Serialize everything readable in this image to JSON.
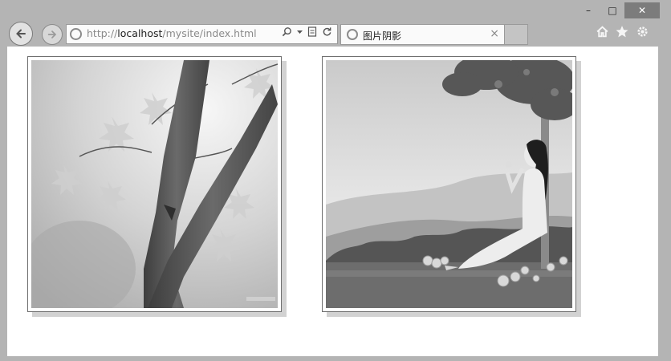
{
  "browser": {
    "address_bar": {
      "scheme": "http://",
      "host": "localhost",
      "path": "/mysite/index.html"
    },
    "tab": {
      "title": "图片阴影",
      "close": "×"
    },
    "window_controls": {
      "minimize": "–",
      "maximize": "□",
      "close": "✕"
    },
    "toolbar_icons": [
      "back-icon",
      "forward-icon",
      "search-icon",
      "dropdown-icon",
      "compatibility-icon",
      "refresh-icon",
      "home-icon",
      "favorites-star-icon",
      "settings-gear-icon"
    ]
  },
  "page": {
    "images": [
      {
        "subject": "tree-branch-with-maple-leaves"
      },
      {
        "subject": "woman-sitting-under-tree"
      }
    ]
  }
}
